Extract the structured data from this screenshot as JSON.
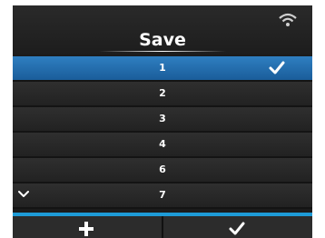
{
  "header": {
    "title": "Save",
    "status_icon": "wifi-icon"
  },
  "list": {
    "items": [
      {
        "label": "1",
        "selected": true,
        "checked": true
      },
      {
        "label": "2",
        "selected": false,
        "checked": false
      },
      {
        "label": "3",
        "selected": false,
        "checked": false
      },
      {
        "label": "4",
        "selected": false,
        "checked": false
      },
      {
        "label": "6",
        "selected": false,
        "checked": false
      },
      {
        "label": "7",
        "selected": false,
        "checked": false
      }
    ],
    "scroll_indicator": "chevron-down-icon"
  },
  "footer": {
    "left_icon": "plus-icon",
    "right_icon": "check-icon"
  },
  "colors": {
    "selected_row": "#1f6db0",
    "accent_bar": "#1e9bd7",
    "background": "#1b1b1b"
  }
}
